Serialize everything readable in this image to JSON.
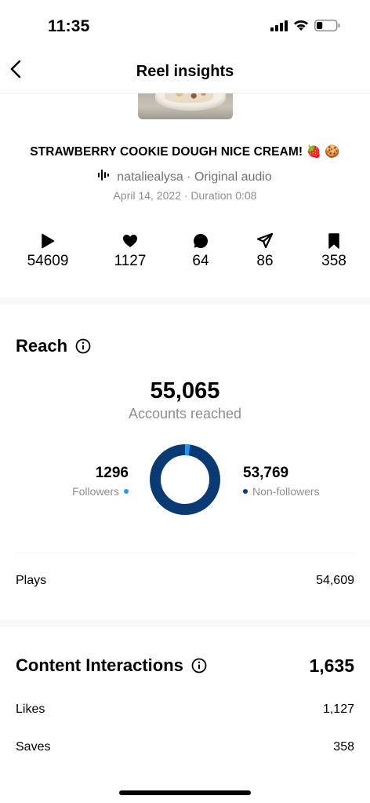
{
  "status_bar": {
    "time": "11:35",
    "icons": [
      "cellular-signal-icon",
      "wifi-icon",
      "battery-icon"
    ],
    "battery_level": 0.3
  },
  "header": {
    "title": "Reel insights",
    "back_icon": "chevron-left-icon"
  },
  "reel": {
    "title": "STRAWBERRY COOKIE DOUGH NICE CREAM! 🍓 🍪",
    "audio": "natalie­alysa · Original audio",
    "meta": "April 14, 2022 · Duration 0:08"
  },
  "stats": [
    {
      "icon": "play-icon",
      "value": "54609"
    },
    {
      "icon": "heart-icon",
      "value": "1127"
    },
    {
      "icon": "comment-icon",
      "value": "64"
    },
    {
      "icon": "share-icon",
      "value": "86"
    },
    {
      "icon": "bookmark-icon",
      "value": "358"
    }
  ],
  "reach": {
    "heading": "Reach",
    "accounts_reached": "55,065",
    "accounts_reached_label": "Accounts reached",
    "followers_value": "1296",
    "followers_label": "Followers",
    "nonfollowers_value": "53,769",
    "nonfollowers_label": "Non-followers",
    "followers_fraction": 0.0235,
    "followers_color": "#1d9bf0",
    "nonfollowers_color": "#0a3a73"
  },
  "plays": {
    "label": "Plays",
    "value": "54,609"
  },
  "content_interactions": {
    "heading": "Content Interactions",
    "total": "1,635",
    "rows": [
      {
        "label": "Likes",
        "value": "1,127"
      },
      {
        "label": "Saves",
        "value": "358"
      }
    ]
  }
}
